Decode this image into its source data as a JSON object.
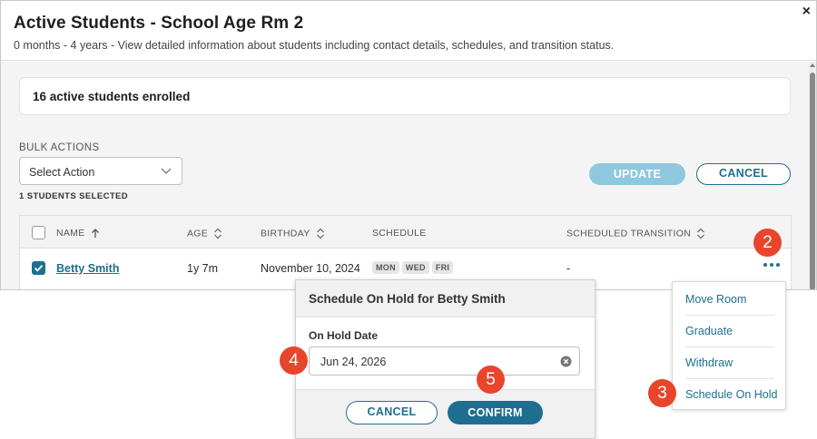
{
  "modal": {
    "title": "Active Students - School Age Rm 2",
    "subtitle": "0 months - 4 years - View detailed information about students including contact details, schedules, and transition status.",
    "close_label": "×"
  },
  "summary": {
    "count_text": "16 active students enrolled"
  },
  "bulk": {
    "label": "BULK ACTIONS",
    "select_value": "Select Action",
    "selected_text": "1 STUDENTS SELECTED",
    "update_label": "UPDATE",
    "cancel_label": "CANCEL"
  },
  "table": {
    "columns": [
      "NAME",
      "AGE",
      "BIRTHDAY",
      "SCHEDULE",
      "SCHEDULED TRANSITION"
    ],
    "row": {
      "name": "Betty Smith",
      "age": "1y 7m",
      "birthday": "November 10, 2024",
      "schedule": [
        "MON",
        "WED",
        "FRI"
      ],
      "transition": "-"
    }
  },
  "menu": {
    "items": [
      "Move Room",
      "Graduate",
      "Withdraw",
      "Schedule On Hold"
    ]
  },
  "popover": {
    "title": "Schedule On Hold for Betty Smith",
    "field_label": "On Hold Date",
    "date_value": "Jun 24, 2026",
    "cancel_label": "CANCEL",
    "confirm_label": "CONFIRM"
  },
  "badges": [
    "2",
    "3",
    "4",
    "5"
  ],
  "colors": {
    "primary": "#1e6f8f",
    "update_disabled": "#8fc7de",
    "badge": "#e8452c"
  },
  "icons": [
    "close-icon",
    "chevron-down-icon",
    "sort-arrow-up-icon",
    "sort-icon",
    "checkbox-icon",
    "more-dots-icon",
    "clear-icon"
  ]
}
